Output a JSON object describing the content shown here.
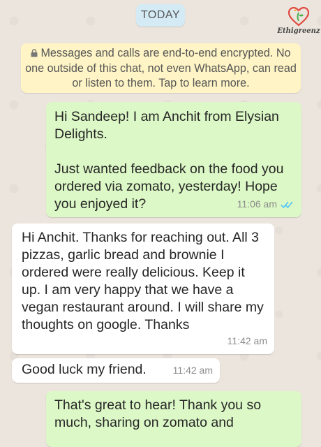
{
  "date_chip": "TODAY",
  "logo_text": "Ethigreenz",
  "encryption_notice": "Messages and calls are end-to-end encrypted. No one outside of this chat, not even WhatsApp, can read or listen to them. Tap to learn more.",
  "messages": [
    {
      "direction": "outgoing",
      "text": "Hi Sandeep! I am Anchit from Elysian Delights.\n\nJust wanted feedback on the food you ordered via zomato, yesterday! Hope you enjoyed it?",
      "time": "11:06 am",
      "status": "read-ticks-icon"
    },
    {
      "direction": "incoming",
      "text": "Hi Anchit. Thanks for reaching out. All 3 pizzas, garlic bread and brownie I ordered were really delicious. Keep it up. I am very happy that we have a vegan restaurant around. I will share my thoughts on google. Thanks",
      "time": "11:42 am"
    },
    {
      "direction": "incoming",
      "text": "Good luck my friend.",
      "time": "11:42 am"
    },
    {
      "direction": "outgoing",
      "text": "That's great to hear! Thank you so much, sharing on zomato and"
    }
  ],
  "colors": {
    "chat_background": "#ECE5DD",
    "outgoing_bubble": "#DCF8C6",
    "incoming_bubble": "#FFFFFF",
    "encryption_banner": "#FEF4C5",
    "date_chip": "#D4EAF4",
    "read_ticks": "#4FC3F7"
  }
}
